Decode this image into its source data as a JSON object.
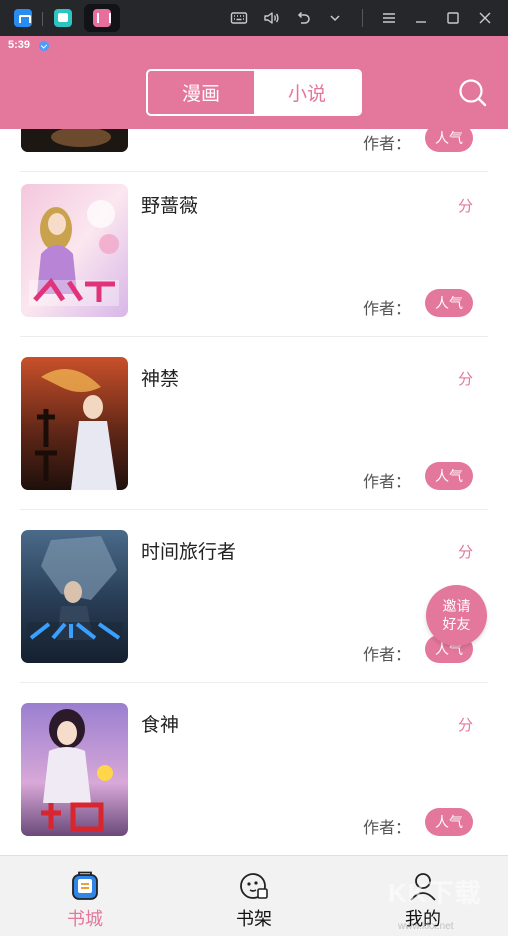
{
  "status": {
    "time": "5:39"
  },
  "header": {
    "tabs": [
      {
        "label": "漫画",
        "active": false
      },
      {
        "label": "小说",
        "active": true
      }
    ]
  },
  "books": [
    {
      "title": "",
      "score": "",
      "author_label": "作者：",
      "badge": "人气"
    },
    {
      "title": "野蔷薇",
      "score": "分",
      "author_label": "作者：",
      "badge": "人气"
    },
    {
      "title": "神禁",
      "score": "分",
      "author_label": "作者：",
      "badge": "人气"
    },
    {
      "title": "时间旅行者",
      "score": "分",
      "author_label": "作者：",
      "badge": "人气"
    },
    {
      "title": "食神",
      "score": "分",
      "author_label": "作者：",
      "badge": "人气"
    }
  ],
  "fab": {
    "line1": "邀请",
    "line2": "好友"
  },
  "nav": [
    {
      "label": "书城",
      "icon": "bookstore-icon",
      "active": true
    },
    {
      "label": "书架",
      "icon": "bookshelf-icon",
      "active": false
    },
    {
      "label": "我的",
      "icon": "profile-icon",
      "active": false
    }
  ],
  "watermark": {
    "text": "KK下载",
    "sub": "www.kkx.net"
  },
  "colors": {
    "accent": "#e4779c",
    "window_bar": "#26272b"
  }
}
